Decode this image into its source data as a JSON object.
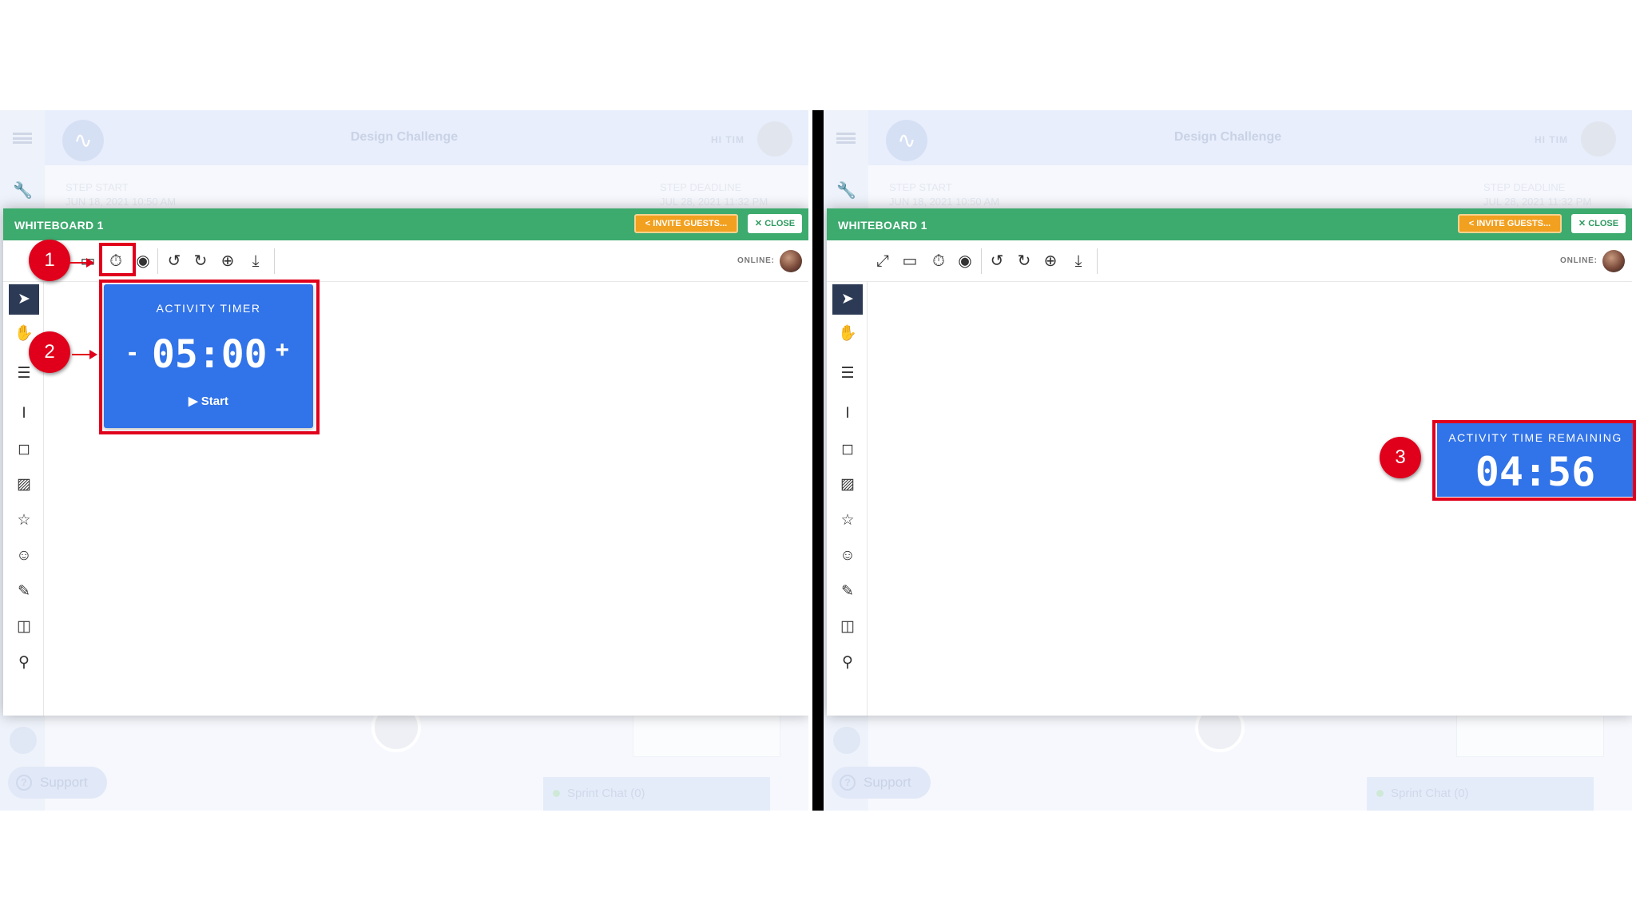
{
  "colors": {
    "whiteboard_header": "#3daa6e",
    "invite_button": "#f2a01f",
    "timer_blue": "#3173e8",
    "annotation_red": "#e1001b",
    "active_tool": "#2c3a56"
  },
  "background_app": {
    "title": "Design Challenge",
    "greeting": "HI TIM",
    "step_start_label": "STEP START",
    "step_start_date": "JUN 18, 2021 10:50 AM",
    "step_deadline_label": "STEP DEADLINE",
    "step_deadline_date": "JUL 28, 2021 11:32 PM",
    "support_label": "Support",
    "support_icon": "?",
    "chat_label": "Sprint Chat (0)"
  },
  "whiteboard": {
    "title": "WHITEBOARD 1",
    "invite_label": "INVITE GUESTS...",
    "close_label": "CLOSE",
    "online_label": "ONLINE:",
    "toolbar_icons": [
      "fullscreen-icon",
      "screen-icon",
      "timer-icon",
      "podcast-icon",
      "undo-icon",
      "redo-icon",
      "zoom-icon",
      "download-icon"
    ],
    "side_tools": [
      "pointer-icon",
      "hand-icon",
      "document-icon",
      "text-cursor-icon",
      "sticky-note-icon",
      "image-icon",
      "star-icon",
      "emoji-icon",
      "pencil-icon",
      "columns-icon",
      "map-pin-icon"
    ]
  },
  "activity_timer": {
    "label": "ACTIVITY TIMER",
    "minus": "-",
    "value": "05:00",
    "plus": "+",
    "start_label": "▶  Start"
  },
  "time_remaining": {
    "label": "ACTIVITY TIME REMAINING",
    "value": "04:56"
  },
  "annotations": {
    "marker_1": "1",
    "marker_2": "2",
    "marker_3": "3"
  }
}
